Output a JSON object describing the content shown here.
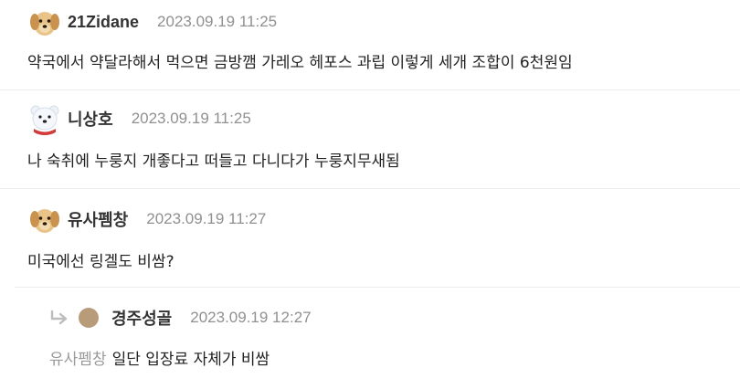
{
  "comments": [
    {
      "nickname": "21Zidane",
      "date": "2023.09.19 11:25",
      "text": "약국에서 약달라해서 먹으면 금방깸 가레오 헤포스 과립 이렇게 세개 조합이 6천원임",
      "avatar": "puppy-avatar-icon"
    },
    {
      "nickname": "니상호",
      "date": "2023.09.19 11:25",
      "text": "나 숙취에 누룽지 개좋다고 떠들고 다니다가 누룽지무새됨",
      "avatar": "polar-bear-avatar-icon"
    },
    {
      "nickname": "유사펨창",
      "date": "2023.09.19 11:27",
      "text": "미국에선 링겔도 비쌈?",
      "avatar": "puppy-avatar-icon"
    }
  ],
  "reply": {
    "nickname": "경주성골",
    "date": "2023.09.19 12:27",
    "mention": "유사펨창",
    "text": "일단 입장료 자체가 비쌈",
    "icon": "reply-arrow-icon"
  }
}
